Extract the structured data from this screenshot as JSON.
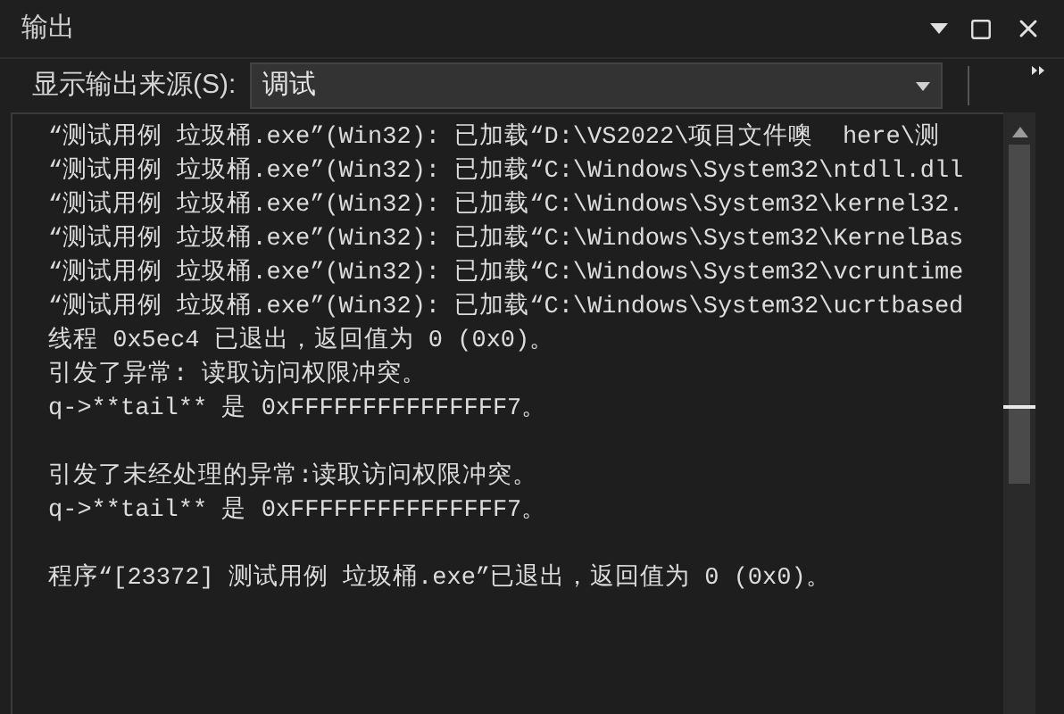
{
  "window": {
    "title": "输出"
  },
  "toolbar": {
    "label": "显示输出来源(S):",
    "source": {
      "value": "调试"
    }
  },
  "output": {
    "blocks": [
      [
        "“测试用例 垃圾桶.exe”(Win32): 已加载“D:\\VS2022\\项目文件噢  here\\测",
        "“测试用例 垃圾桶.exe”(Win32): 已加载“C:\\Windows\\System32\\ntdll.dll",
        "“测试用例 垃圾桶.exe”(Win32): 已加载“C:\\Windows\\System32\\kernel32.",
        "“测试用例 垃圾桶.exe”(Win32): 已加载“C:\\Windows\\System32\\KernelBas",
        "“测试用例 垃圾桶.exe”(Win32): 已加载“C:\\Windows\\System32\\vcruntime",
        "“测试用例 垃圾桶.exe”(Win32): 已加载“C:\\Windows\\System32\\ucrtbased",
        "线程 0x5ec4 已退出，返回值为 0 (0x0)。",
        "引发了异常: 读取访问权限冲突。",
        "q->**tail** 是 0xFFFFFFFFFFFFFFF7。"
      ],
      [
        "引发了未经处理的异常:读取访问权限冲突。",
        "q->**tail** 是 0xFFFFFFFFFFFFFFF7。"
      ],
      [
        "程序“[23372] 测试用例 垃圾桶.exe”已退出，返回值为 0 (0x0)。"
      ]
    ]
  }
}
